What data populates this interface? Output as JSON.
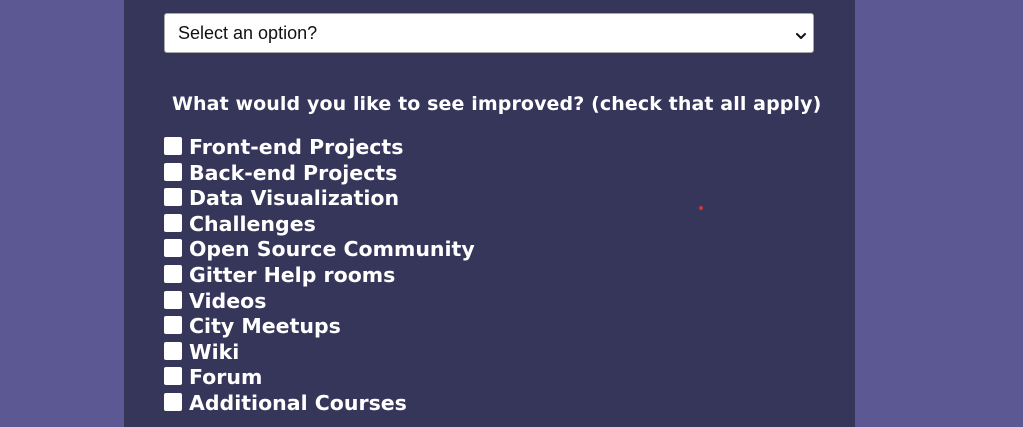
{
  "survey": {
    "select": {
      "value": "Select an option?",
      "icon": "chevron-down-icon"
    },
    "question": "What would you like to see improved? (check that all apply)",
    "options": [
      {
        "label": "Front-end Projects",
        "checked": false
      },
      {
        "label": "Back-end Projects",
        "checked": false
      },
      {
        "label": "Data Visualization",
        "checked": false
      },
      {
        "label": "Challenges",
        "checked": false
      },
      {
        "label": "Open Source Community",
        "checked": false
      },
      {
        "label": "Gitter Help rooms",
        "checked": false
      },
      {
        "label": "Videos",
        "checked": false
      },
      {
        "label": "City Meetups",
        "checked": false
      },
      {
        "label": "Wiki",
        "checked": false
      },
      {
        "label": "Forum",
        "checked": false
      },
      {
        "label": "Additional Courses",
        "checked": false
      }
    ]
  },
  "colors": {
    "page_background": "#5b5893",
    "panel_background": "#36355a",
    "text": "#ffffff",
    "cursor_dot": "#d43535"
  }
}
